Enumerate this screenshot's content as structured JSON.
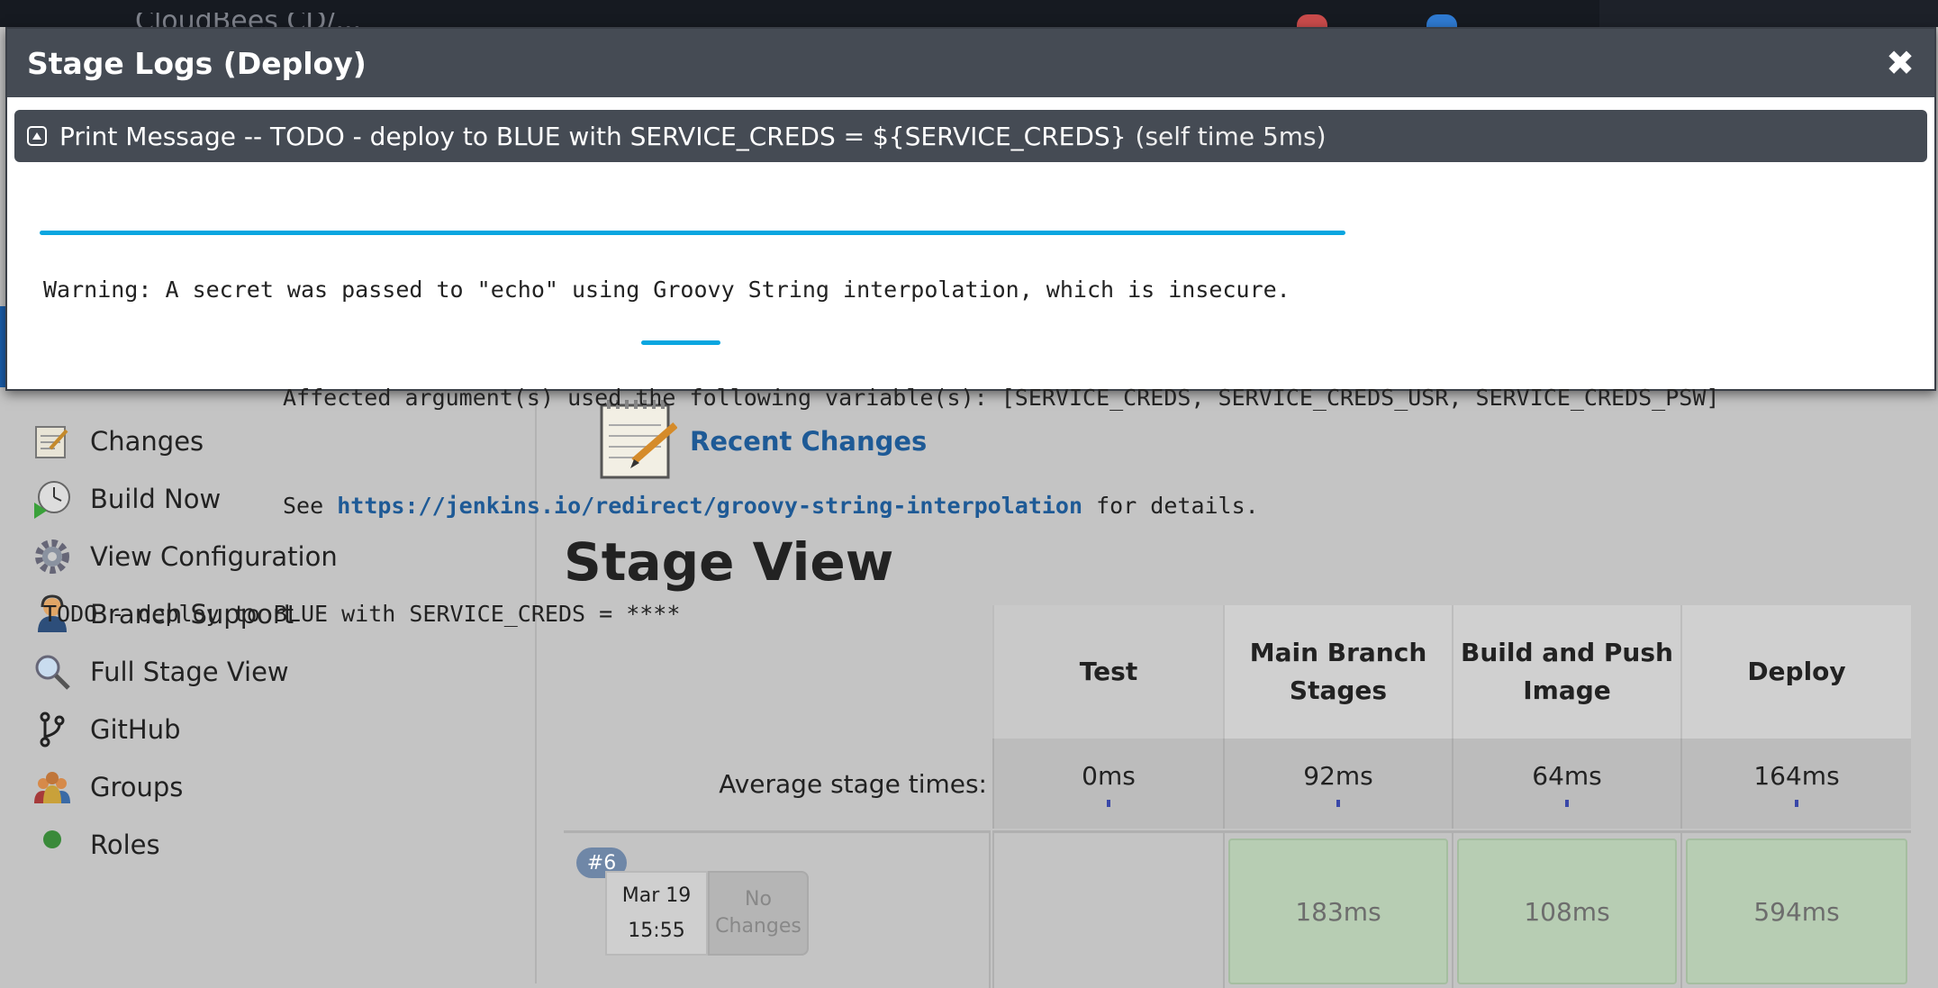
{
  "topbar": {
    "title": "CloudBees CD/..."
  },
  "modal": {
    "title": "Stage Logs (Deploy)",
    "step": {
      "name": "Print Message -- TODO - deploy to BLUE with SERVICE_CREDS = ${SERVICE_CREDS}",
      "time": "(self time 5ms)"
    },
    "log": {
      "line1": "Warning: A secret was passed to \"echo\" using Groovy String interpolation, which is insecure.",
      "line2": "Affected argument(s) used the following variable(s): [SERVICE_CREDS, SERVICE_CREDS_USR, SERVICE_CREDS_PSW]",
      "line3_prefix": "See ",
      "line3_link": "https://jenkins.io/redirect/groovy-string-interpolation",
      "line3_suffix": " for details.",
      "line4": "TODO - deploy to BLUE with SERVICE_CREDS = ****"
    }
  },
  "sidebar": {
    "items": [
      {
        "label": "Changes",
        "icon": "notepad-icon"
      },
      {
        "label": "Build Now",
        "icon": "clock-play-icon"
      },
      {
        "label": "View Configuration",
        "icon": "gear-icon"
      },
      {
        "label": "Branch Support",
        "icon": "support-person-icon"
      },
      {
        "label": "Full Stage View",
        "icon": "magnifier-icon"
      },
      {
        "label": "GitHub",
        "icon": "branch-icon"
      },
      {
        "label": "Groups",
        "icon": "group-icon"
      },
      {
        "label": "Roles",
        "icon": "roles-icon"
      }
    ]
  },
  "main": {
    "recent_changes": "Recent Changes",
    "stage_view_title": "Stage View",
    "stages": [
      "Test",
      "Main Branch Stages",
      "Build and Push Image",
      "Deploy"
    ],
    "avg_label": "Average stage times:",
    "avg_times": [
      "0ms",
      "92ms",
      "64ms",
      "164ms"
    ],
    "run": {
      "number": "#6",
      "date": "Mar 19",
      "time": "15:55",
      "changes": "No Changes",
      "durations": [
        "",
        "183ms",
        "108ms",
        "594ms"
      ]
    }
  },
  "colors": {
    "accent": "#0aa6e0",
    "modal_header": "#454b54",
    "link": "#1e5a96",
    "success": "#b7cdb3"
  }
}
